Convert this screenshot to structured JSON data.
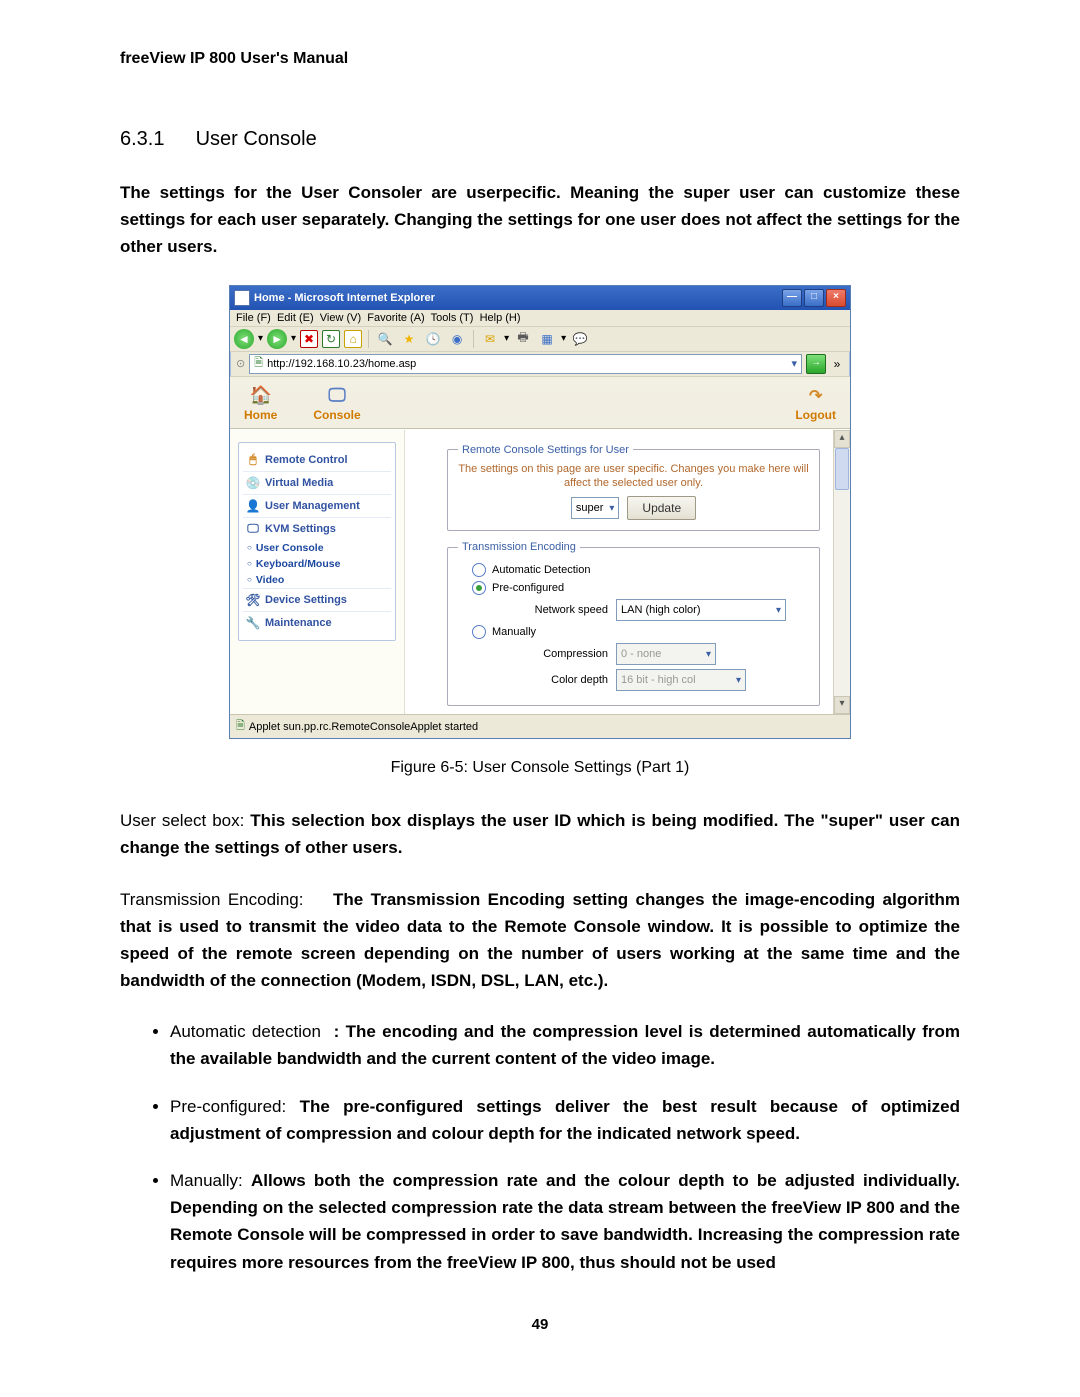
{
  "header": "freeView IP 800 User's Manual",
  "section": {
    "number": "6.3.1",
    "title": "User Console"
  },
  "intro": "The settings for the User Consoler are userpecific. Meaning the super user can customize these settings for each user separately. Changing the settings for one user does not affect the settings for the other users.",
  "caption": "Figure 6-5: User Console Settings (Part 1)",
  "after": {
    "p1_lead": "User select box: ",
    "p1_bold": "This selection box displays the user ID which is being modified. The \"super\" user can change the settings of other users.",
    "p2_lead": "Transmission Encoding: ",
    "p2_bold": "The Transmission Encoding setting changes the image-encoding algorithm that is used to transmit the video data to the Remote Console window. It is possible to optimize the speed of the remote screen depending on the number of users working at the same time and the bandwidth of the connection (Modem, ISDN, DSL, LAN, etc.).",
    "b1_lead": "Automatic detection ",
    "b1_bold": ": The encoding and the compression level is determined automatically from the available bandwidth and the current content of the video image.",
    "b2_lead": "Pre-configured: ",
    "b2_bold": "The pre-configured settings deliver the best result because of optimized adjustment of compression and colour depth for the indicated network speed.",
    "b3_lead": "Manually: ",
    "b3_bold": "Allows both the compression rate and the colour depth to be adjusted individually. Depending on the selected compression rate the data stream between the freeView IP 800 and the Remote Console will be compressed in order to save bandwidth. Increasing the compression rate requires more resources from the freeView IP 800, thus should not be used"
  },
  "page_number": "49",
  "ie": {
    "title": "Home - Microsoft Internet Explorer",
    "menus": {
      "file": "File (F)",
      "edit": "Edit (E)",
      "view": "View (V)",
      "fav": "Favorite (A)",
      "tools": "Tools (T)",
      "help": "Help (H)"
    },
    "address": "http://192.168.10.23/home.asp",
    "status": "Applet sun.pp.rc.RemoteConsoleApplet started"
  },
  "nav": {
    "home": "Home",
    "console": "Console",
    "logout": "Logout"
  },
  "menu": {
    "remote": "Remote Control",
    "vmedia": "Virtual Media",
    "usermgmt": "User Management",
    "kvm": "KVM Settings",
    "kvm_items": {
      "uc": "User Console",
      "km": "Keyboard/Mouse",
      "vid": "Video"
    },
    "devset": "Device Settings",
    "maint": "Maintenance"
  },
  "panel": {
    "fs1_title": "Remote Console Settings for User",
    "fs1_desc": "The settings on this page are user specific. Changes you make here will affect the selected user only.",
    "user_value": "super",
    "update": "Update",
    "fs2_title": "Transmission Encoding",
    "opt_auto": "Automatic Detection",
    "opt_pre": "Pre-configured",
    "ns_label": "Network speed",
    "ns_value": "LAN (high color)",
    "opt_manual": "Manually",
    "comp_label": "Compression",
    "comp_value": "0 - none",
    "cd_label": "Color depth",
    "cd_value": "16 bit - high col"
  }
}
